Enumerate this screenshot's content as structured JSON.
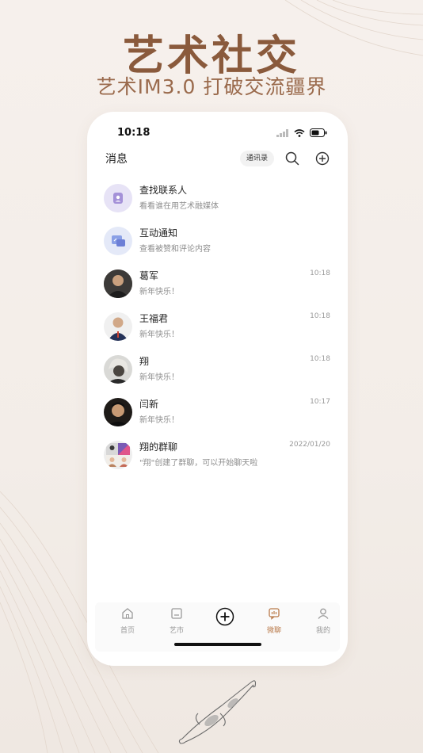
{
  "hero": {
    "title": "艺术社交",
    "subtitle": "艺术IM3.0 打破交流疆界"
  },
  "status_bar": {
    "time": "10:18"
  },
  "header": {
    "title": "消息",
    "contacts_label": "通讯录"
  },
  "conversations": [
    {
      "name": "查找联系人",
      "preview": "看看谁在用艺术融媒体",
      "time": "",
      "avatar": "find-contact-icon"
    },
    {
      "name": "互动通知",
      "preview": "查看被赞和评论内容",
      "time": "",
      "avatar": "notification-icon"
    },
    {
      "name": "葛军",
      "preview": "新年快乐！",
      "time": "10:18",
      "avatar": "photo"
    },
    {
      "name": "王福君",
      "preview": "新年快乐！",
      "time": "10:18",
      "avatar": "photo"
    },
    {
      "name": "翔",
      "preview": "新年快乐！",
      "time": "10:18",
      "avatar": "photo"
    },
    {
      "name": "闫新",
      "preview": "新年快乐！",
      "time": "10:17",
      "avatar": "photo"
    },
    {
      "name": "翔的群聊",
      "preview": "\"翔\"创建了群聊，可以开始聊天啦",
      "time": "2022/01/20",
      "avatar": "group"
    }
  ],
  "tabbar": {
    "items": [
      {
        "label": "首页",
        "icon": "home-icon"
      },
      {
        "label": "艺市",
        "icon": "market-icon"
      },
      {
        "label": "",
        "icon": "plus-circle-icon"
      },
      {
        "label": "微聊",
        "icon": "chat-icon",
        "active": true
      },
      {
        "label": "我的",
        "icon": "profile-icon"
      }
    ]
  },
  "colors": {
    "accent": "#b97a4a",
    "hero_title": "#8a5a3c",
    "background": "#f4eee9"
  }
}
